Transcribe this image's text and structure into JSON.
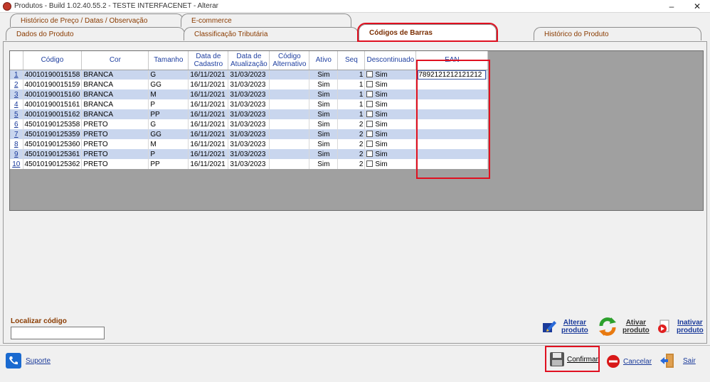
{
  "window": {
    "title": "Produtos - Build 1.02.40.55.2 - TESTE INTERFACENET - Alterar",
    "minimize": "–",
    "close": "✕"
  },
  "tabs_top": [
    {
      "label": "Histórico de Preço / Datas / Observação"
    },
    {
      "label": "E-commerce"
    }
  ],
  "tabs_bottom": [
    {
      "label": "Dados do Produto"
    },
    {
      "label": "Classificação Tributária"
    },
    {
      "label": "Códigos de Barras"
    },
    {
      "label": "Histórico do Produto"
    }
  ],
  "grid": {
    "columns": [
      "Código",
      "Cor",
      "Tamanho",
      "Data de Cadastro",
      "Data de Atualização",
      "Código Alternativo",
      "Ativo",
      "Seq",
      "Descontinuado",
      "EAN"
    ],
    "rows": [
      {
        "n": "1",
        "codigo": "40010190015158",
        "cor": "BRANCA",
        "tamanho": "G",
        "cadastro": "16/11/2021",
        "atualizacao": "31/03/2023",
        "alt": "",
        "ativo": "Sim",
        "seq": "1",
        "desc": "Sim",
        "ean": "7892121212121212"
      },
      {
        "n": "2",
        "codigo": "40010190015159",
        "cor": "BRANCA",
        "tamanho": "GG",
        "cadastro": "16/11/2021",
        "atualizacao": "31/03/2023",
        "alt": "",
        "ativo": "Sim",
        "seq": "1",
        "desc": "Sim",
        "ean": ""
      },
      {
        "n": "3",
        "codigo": "40010190015160",
        "cor": "BRANCA",
        "tamanho": "M",
        "cadastro": "16/11/2021",
        "atualizacao": "31/03/2023",
        "alt": "",
        "ativo": "Sim",
        "seq": "1",
        "desc": "Sim",
        "ean": ""
      },
      {
        "n": "4",
        "codigo": "40010190015161",
        "cor": "BRANCA",
        "tamanho": "P",
        "cadastro": "16/11/2021",
        "atualizacao": "31/03/2023",
        "alt": "",
        "ativo": "Sim",
        "seq": "1",
        "desc": "Sim",
        "ean": ""
      },
      {
        "n": "5",
        "codigo": "40010190015162",
        "cor": "BRANCA",
        "tamanho": "PP",
        "cadastro": "16/11/2021",
        "atualizacao": "31/03/2023",
        "alt": "",
        "ativo": "Sim",
        "seq": "1",
        "desc": "Sim",
        "ean": ""
      },
      {
        "n": "6",
        "codigo": "45010190125358",
        "cor": "PRETO",
        "tamanho": "G",
        "cadastro": "16/11/2021",
        "atualizacao": "31/03/2023",
        "alt": "",
        "ativo": "Sim",
        "seq": "2",
        "desc": "Sim",
        "ean": ""
      },
      {
        "n": "7",
        "codigo": "45010190125359",
        "cor": "PRETO",
        "tamanho": "GG",
        "cadastro": "16/11/2021",
        "atualizacao": "31/03/2023",
        "alt": "",
        "ativo": "Sim",
        "seq": "2",
        "desc": "Sim",
        "ean": ""
      },
      {
        "n": "8",
        "codigo": "45010190125360",
        "cor": "PRETO",
        "tamanho": "M",
        "cadastro": "16/11/2021",
        "atualizacao": "31/03/2023",
        "alt": "",
        "ativo": "Sim",
        "seq": "2",
        "desc": "Sim",
        "ean": ""
      },
      {
        "n": "9",
        "codigo": "45010190125361",
        "cor": "PRETO",
        "tamanho": "P",
        "cadastro": "16/11/2021",
        "atualizacao": "31/03/2023",
        "alt": "",
        "ativo": "Sim",
        "seq": "2",
        "desc": "Sim",
        "ean": ""
      },
      {
        "n": "10",
        "codigo": "45010190125362",
        "cor": "PRETO",
        "tamanho": "PP",
        "cadastro": "16/11/2021",
        "atualizacao": "31/03/2023",
        "alt": "",
        "ativo": "Sim",
        "seq": "2",
        "desc": "Sim",
        "ean": ""
      }
    ]
  },
  "locate": {
    "label": "Localizar código",
    "value": ""
  },
  "actions": {
    "alterar": [
      "Alterar",
      "produto"
    ],
    "ativar": [
      "Ativar",
      "produto"
    ],
    "inativar": [
      "Inativar",
      "produto"
    ]
  },
  "bottom": {
    "suporte": "Suporte",
    "confirmar": "Confirmar",
    "cancelar": "Cancelar",
    "sair": "Sair"
  },
  "colors": {
    "accent_red": "#e01020",
    "tab_text": "#8a3b00",
    "row_alt": "#c9d6ee",
    "link_blue": "#1a3a9a"
  },
  "icons": {
    "app": "app-logo-icon",
    "alterar": "edit-product-icon",
    "ativar": "recycle-arrows-icon",
    "inativar": "inactivate-icon",
    "suporte": "phone-icon",
    "confirmar": "floppy-disk-icon",
    "cancelar": "cancel-icon",
    "sair": "exit-door-icon"
  }
}
